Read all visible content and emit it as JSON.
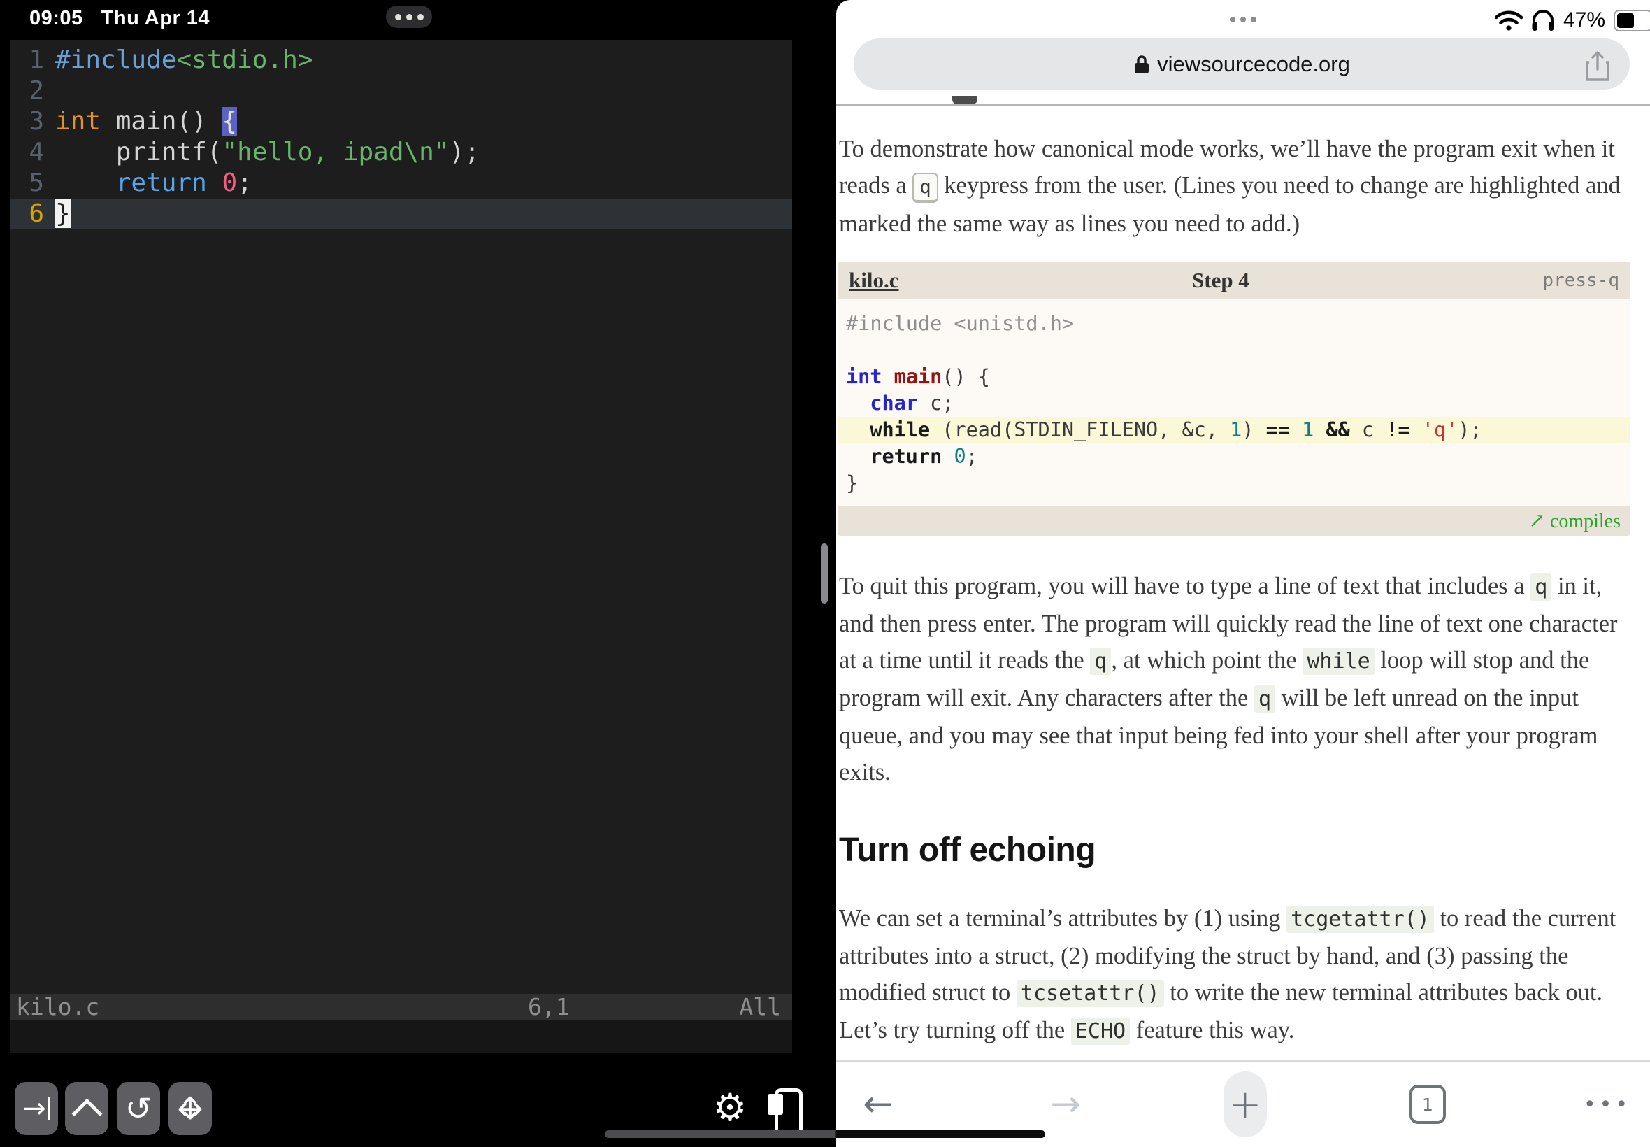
{
  "status_bar": {
    "time": "09:05",
    "date": "Thu Apr 14",
    "battery_percent": "47%",
    "icons": [
      "wifi-icon",
      "headphones-icon",
      "battery-icon"
    ]
  },
  "terminal": {
    "window_dots": "•••",
    "editor_lines": [
      {
        "num": "1",
        "tokens": [
          {
            "t": "#include",
            "c": "tk-pre"
          },
          {
            "t": "<stdio.h>",
            "c": "tk-str"
          }
        ]
      },
      {
        "num": "2",
        "tokens": []
      },
      {
        "num": "3",
        "tokens": [
          {
            "t": "int",
            "c": "tk-type"
          },
          {
            "t": " main() ",
            "c": "tk-plain"
          },
          {
            "t": "{",
            "c": "tk-brace-hl"
          }
        ]
      },
      {
        "num": "4",
        "tokens": [
          {
            "t": "    printf(",
            "c": "tk-plain"
          },
          {
            "t": "\"hello, ipad\\n\"",
            "c": "tk-str"
          },
          {
            "t": ");",
            "c": "tk-plain"
          }
        ]
      },
      {
        "num": "5",
        "tokens": [
          {
            "t": "    ",
            "c": "tk-plain"
          },
          {
            "t": "return",
            "c": "tk-kw"
          },
          {
            "t": " ",
            "c": "tk-plain"
          },
          {
            "t": "0",
            "c": "tk-num"
          },
          {
            "t": ";",
            "c": "tk-plain"
          }
        ]
      },
      {
        "num": "6",
        "current": true,
        "tokens": [
          {
            "t": "}",
            "c": "tk-cursor"
          }
        ]
      }
    ],
    "statusline": {
      "file": "kilo.c",
      "position": "6,1",
      "scroll": "All"
    },
    "toolbar_icons": [
      "tab-key-icon",
      "caret-key-icon",
      "undo-icon",
      "move-arrows-icon",
      "gear-icon",
      "paste-icon"
    ]
  },
  "safari": {
    "window_dots": "•••",
    "url": "viewsourcecode.org",
    "lock_icon": "lock-icon",
    "share_icon": "share-icon",
    "paragraph1": [
      {
        "t": "To demonstrate how canonical mode works, we’ll have the program exit when it reads a ",
        "c": ""
      },
      {
        "t": "q",
        "c": "kbd"
      },
      {
        "t": " keypress from the user. (Lines you need to change are highlighted and marked the same way as lines you need to add.)",
        "c": ""
      }
    ],
    "code_box": {
      "file": "kilo.c",
      "step": "Step 4",
      "tag": "press-q",
      "lines": [
        {
          "tokens": [
            {
              "t": "#include <unistd.h>",
              "c": "cb-gray"
            }
          ]
        },
        {
          "tokens": []
        },
        {
          "tokens": [
            {
              "t": "int",
              "c": "cb-kw"
            },
            {
              "t": " ",
              "c": "cb-plain"
            },
            {
              "t": "main",
              "c": "cb-fn"
            },
            {
              "t": "() {",
              "c": "cb-plain"
            }
          ]
        },
        {
          "tokens": [
            {
              "t": "  ",
              "c": "cb-plain"
            },
            {
              "t": "char",
              "c": "cb-kw"
            },
            {
              "t": " c;",
              "c": "cb-plain"
            }
          ]
        },
        {
          "hl": true,
          "tokens": [
            {
              "t": "  ",
              "c": "cb-plain"
            },
            {
              "t": "while",
              "c": "cb-bold"
            },
            {
              "t": " (read(STDIN_FILENO, &c, ",
              "c": "cb-plain"
            },
            {
              "t": "1",
              "c": "cb-num"
            },
            {
              "t": ") ",
              "c": "cb-plain"
            },
            {
              "t": "==",
              "c": "cb-bold"
            },
            {
              "t": " ",
              "c": "cb-plain"
            },
            {
              "t": "1",
              "c": "cb-num"
            },
            {
              "t": " ",
              "c": "cb-plain"
            },
            {
              "t": "&&",
              "c": "cb-bold"
            },
            {
              "t": " c ",
              "c": "cb-plain"
            },
            {
              "t": "!=",
              "c": "cb-bold"
            },
            {
              "t": " ",
              "c": "cb-plain"
            },
            {
              "t": "'q'",
              "c": "cb-str"
            },
            {
              "t": ");",
              "c": "cb-plain"
            }
          ]
        },
        {
          "tokens": [
            {
              "t": "  ",
              "c": "cb-plain"
            },
            {
              "t": "return",
              "c": "cb-bold"
            },
            {
              "t": " ",
              "c": "cb-plain"
            },
            {
              "t": "0",
              "c": "cb-num"
            },
            {
              "t": ";",
              "c": "cb-plain"
            }
          ]
        },
        {
          "tokens": [
            {
              "t": "}",
              "c": "cb-plain"
            }
          ]
        }
      ],
      "footer_arrow": "↗",
      "footer_label": "compiles"
    },
    "paragraph2": [
      {
        "t": "To quit this program, you will have to type a line of text that includes a ",
        "c": ""
      },
      {
        "t": "q",
        "c": "code"
      },
      {
        "t": " in it, and then press enter. The program will quickly read the line of text one character at a time until it reads the ",
        "c": ""
      },
      {
        "t": "q",
        "c": "code"
      },
      {
        "t": ", at which point the ",
        "c": ""
      },
      {
        "t": "while",
        "c": "code"
      },
      {
        "t": " loop will stop and the program will exit. Any characters after the ",
        "c": ""
      },
      {
        "t": "q",
        "c": "code"
      },
      {
        "t": " will be left unread on the input queue, and you may see that input being fed into your shell after your program exits.",
        "c": ""
      }
    ],
    "heading": "Turn off echoing",
    "paragraph3": [
      {
        "t": "We can set a terminal’s attributes by (1) using ",
        "c": ""
      },
      {
        "t": "tcgetattr()",
        "c": "code"
      },
      {
        "t": " to read the current attributes into a struct, (2) modifying the struct by hand, and (3) passing the modified struct to ",
        "c": ""
      },
      {
        "t": "tcsetattr()",
        "c": "code"
      },
      {
        "t": " to write the new terminal attributes back out. Let’s try turning off the ",
        "c": ""
      },
      {
        "t": "ECHO",
        "c": "code"
      },
      {
        "t": " feature this way.",
        "c": ""
      }
    ],
    "toolbar": {
      "back": "←",
      "forward": "→",
      "plus": "+",
      "tab_count": "1",
      "more": "•••"
    }
  }
}
